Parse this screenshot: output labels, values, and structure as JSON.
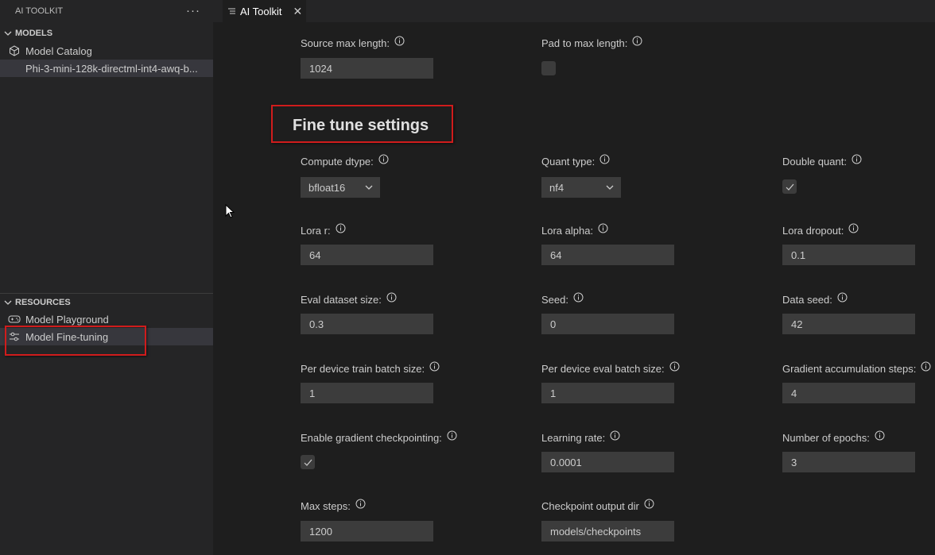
{
  "sidebar": {
    "title": "AI TOOLKIT",
    "more": "···",
    "models_section": "MODELS",
    "models_items": [
      {
        "label": "Model Catalog",
        "icon": "cube-icon"
      },
      {
        "label": "Phi-3-mini-128k-directml-int4-awq-b..."
      }
    ],
    "resources_section": "RESOURCES",
    "resources_items": [
      {
        "label": "Model Playground",
        "icon": "gamepad-icon"
      },
      {
        "label": "Model Fine-tuning",
        "icon": "sliders-icon"
      }
    ]
  },
  "tab": {
    "label": "AI Toolkit",
    "close": "✕"
  },
  "top_fields": {
    "source_max_length": {
      "label": "Source max length:",
      "value": "1024"
    },
    "pad_to_max_length": {
      "label": "Pad to max length:",
      "checked": false
    }
  },
  "section_title": "Fine tune settings",
  "fields": {
    "compute_dtype": {
      "label": "Compute dtype:",
      "value": "bfloat16"
    },
    "quant_type": {
      "label": "Quant type:",
      "value": "nf4"
    },
    "double_quant": {
      "label": "Double quant:",
      "checked": true
    },
    "lora_r": {
      "label": "Lora r:",
      "value": "64"
    },
    "lora_alpha": {
      "label": "Lora alpha:",
      "value": "64"
    },
    "lora_dropout": {
      "label": "Lora dropout:",
      "value": "0.1"
    },
    "eval_dataset_size": {
      "label": "Eval dataset size:",
      "value": "0.3"
    },
    "seed": {
      "label": "Seed:",
      "value": "0"
    },
    "data_seed": {
      "label": "Data seed:",
      "value": "42"
    },
    "per_device_train_batch_size": {
      "label": "Per device train batch size:",
      "value": "1"
    },
    "per_device_eval_batch_size": {
      "label": "Per device eval batch size:",
      "value": "1"
    },
    "gradient_accumulation_steps": {
      "label": "Gradient accumulation steps:",
      "value": "4"
    },
    "enable_gradient_checkpointing": {
      "label": "Enable gradient checkpointing:",
      "checked": true
    },
    "learning_rate": {
      "label": "Learning rate:",
      "value": "0.0001"
    },
    "number_of_epochs": {
      "label": "Number of epochs:",
      "value": "3"
    },
    "max_steps": {
      "label": "Max steps:",
      "value": "1200"
    },
    "checkpoint_output_dir": {
      "label": "Checkpoint output dir",
      "value": "models/checkpoints"
    }
  },
  "colors": {
    "highlight": "#d01c1c",
    "input_bg": "#3c3c3c",
    "sidebar_bg": "#252526",
    "editor_bg": "#1e1e1e"
  }
}
